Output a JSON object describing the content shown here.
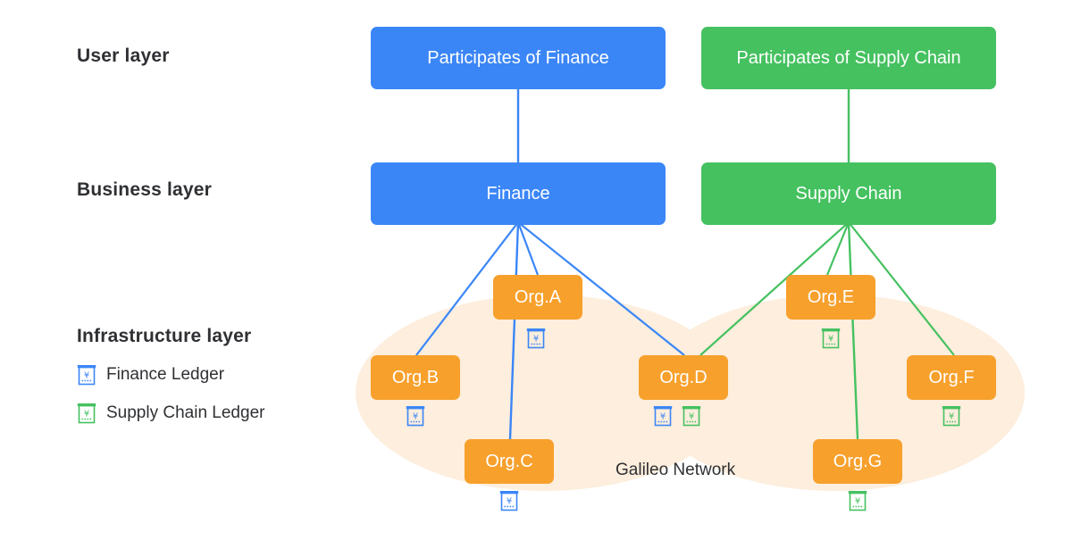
{
  "diagram": {
    "network_caption": "Galileo Network",
    "colors": {
      "finance_blue": "#3b86f7",
      "supply_green": "#45c160",
      "org_orange": "#f7a02c",
      "network_ellipse": "#fdeedd",
      "text_dark": "#2f3033"
    }
  },
  "layers": [
    {
      "id": "user",
      "label": "User layer"
    },
    {
      "id": "business",
      "label": "Business layer"
    },
    {
      "id": "infrastructure",
      "label": "Infrastructure layer"
    }
  ],
  "legend": [
    {
      "icon": "finance-ledger-icon",
      "label": "Finance Ledger",
      "color": "#3b86f7"
    },
    {
      "icon": "supply-chain-ledger-icon",
      "label": "Supply Chain Ledger",
      "color": "#45c160"
    }
  ],
  "user_layer": {
    "nodes": [
      {
        "id": "participates-finance",
        "label": "Participates of Finance",
        "color": "#3b86f7"
      },
      {
        "id": "participates-supply-chain",
        "label": "Participates of Supply Chain",
        "color": "#45c160"
      }
    ]
  },
  "business_layer": {
    "nodes": [
      {
        "id": "finance",
        "label": "Finance",
        "color": "#3b86f7"
      },
      {
        "id": "supply-chain",
        "label": "Supply Chain",
        "color": "#45c160"
      }
    ]
  },
  "infrastructure_layer": {
    "network_label": "Galileo Network",
    "orgs": [
      {
        "id": "org-a",
        "label": "Org.A",
        "ledgers": [
          "finance"
        ]
      },
      {
        "id": "org-b",
        "label": "Org.B",
        "ledgers": [
          "finance"
        ]
      },
      {
        "id": "org-c",
        "label": "Org.C",
        "ledgers": [
          "finance"
        ]
      },
      {
        "id": "org-d",
        "label": "Org.D",
        "ledgers": [
          "finance",
          "supply"
        ]
      },
      {
        "id": "org-e",
        "label": "Org.E",
        "ledgers": [
          "supply"
        ]
      },
      {
        "id": "org-f",
        "label": "Org.F",
        "ledgers": [
          "supply"
        ]
      },
      {
        "id": "org-g",
        "label": "Org.G",
        "ledgers": [
          "supply"
        ]
      }
    ]
  },
  "connections": [
    {
      "from": "participates-finance",
      "to": "finance",
      "color": "#3b86f7"
    },
    {
      "from": "participates-supply-chain",
      "to": "supply-chain",
      "color": "#45c160"
    },
    {
      "from": "finance",
      "to": "org-a",
      "color": "#3b86f7"
    },
    {
      "from": "finance",
      "to": "org-b",
      "color": "#3b86f7"
    },
    {
      "from": "finance",
      "to": "org-c",
      "color": "#3b86f7"
    },
    {
      "from": "finance",
      "to": "org-d",
      "color": "#3b86f7"
    },
    {
      "from": "supply-chain",
      "to": "org-d",
      "color": "#45c160"
    },
    {
      "from": "supply-chain",
      "to": "org-e",
      "color": "#45c160"
    },
    {
      "from": "supply-chain",
      "to": "org-f",
      "color": "#45c160"
    },
    {
      "from": "supply-chain",
      "to": "org-g",
      "color": "#45c160"
    }
  ]
}
